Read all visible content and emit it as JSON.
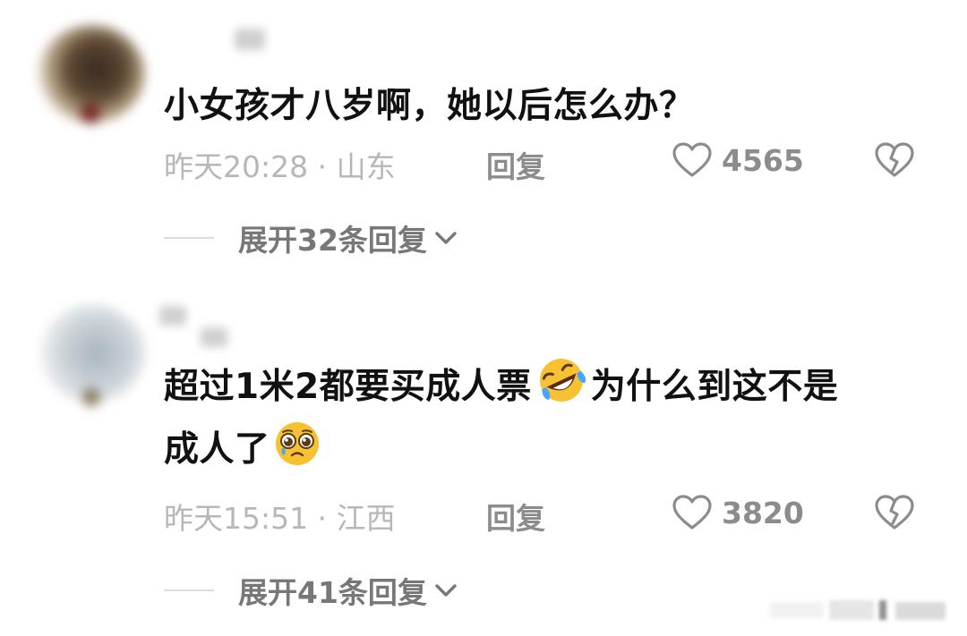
{
  "comments": [
    {
      "avatar_icon": "blurred-avatar",
      "text": "小女孩才八岁啊，她以后怎么办？",
      "time_location": "昨天20:28 · 山东",
      "reply_label": "回复",
      "like_count": "4565",
      "like_icon": "heart-outline-icon",
      "dislike_icon": "broken-heart-icon",
      "expand_label": "展开32条回复"
    },
    {
      "avatar_icon": "blurred-avatar",
      "text_line1_a": "超过1米2都要买成人票",
      "emoji1": "rolling-on-floor-laughing-emoji",
      "text_line1_b": "为什么到这不是",
      "text_line2": "成人了",
      "emoji2": "pleading-face-emoji",
      "time_location": "昨天15:51 · 江西",
      "reply_label": "回复",
      "like_count": "3820",
      "like_icon": "heart-outline-icon",
      "dislike_icon": "broken-heart-icon",
      "expand_label": "展开41条回复"
    }
  ],
  "colors": {
    "text": "#111111",
    "meta": "#b7b7b7",
    "action": "#8c8c8c",
    "expand": "#777777",
    "divider": "#dcdcdc",
    "background": "#ffffff"
  }
}
